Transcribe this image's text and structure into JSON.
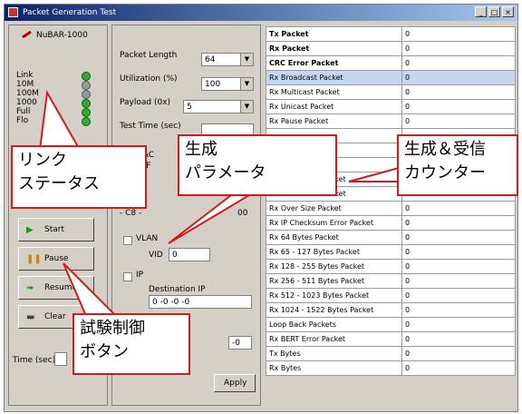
{
  "window": {
    "title": "Packet Generation Test",
    "min": "_",
    "max": "□",
    "close": "×"
  },
  "device": {
    "name": "NuBAR-1000"
  },
  "status_leds": [
    {
      "label": "Link",
      "state": "green"
    },
    {
      "label": "10M",
      "state": "gray"
    },
    {
      "label": "100M",
      "state": "gray"
    },
    {
      "label": "1000",
      "state": "green"
    },
    {
      "label": "Full",
      "state": "green"
    },
    {
      "label": "Flo",
      "state": "green"
    }
  ],
  "params": {
    "packet_length_label": "Packet Length",
    "packet_length_value": "64",
    "utilization_label": "Utilization (%)",
    "utilization_value": "100",
    "payload_label": "Payload (0x)",
    "payload_value": "5",
    "test_time_label": "Test Time (sec)",
    "mac_label": "MAC",
    "mac_value": "- FF",
    "mac2_value": "- C8 -",
    "mac2_tail": "00",
    "vlan_label": "VLAN",
    "vid_label": "VID",
    "vid_value": "0",
    "ip_label": "IP",
    "dest_ip_label": "Destination IP",
    "dest_ip_value": "0   -0   -0   -0",
    "src_tail": "-0",
    "apply_label": "Apply"
  },
  "controls": {
    "start": "Start",
    "pause": "Pause",
    "resume": "Resume",
    "clear": "Clear",
    "time_label": "Time (sec)"
  },
  "counters": [
    {
      "name": "Tx Packet",
      "value": "0",
      "bold": true
    },
    {
      "name": "Rx Packet",
      "value": "0",
      "bold": true
    },
    {
      "name": "CRC Error Packet",
      "value": "0",
      "bold": true
    },
    {
      "name": "Rx Broadcast Packet",
      "value": "0",
      "hl": true
    },
    {
      "name": "Rx Multicast Packet",
      "value": "0"
    },
    {
      "name": "Rx Unicast Packet",
      "value": "0"
    },
    {
      "name": "Rx Pause Packet",
      "value": "0"
    },
    {
      "name": "",
      "value": ""
    },
    {
      "name": "",
      "value": ""
    },
    {
      "name": "",
      "value": ""
    },
    {
      "name": "Rx Under Size Packet",
      "value": "0"
    },
    {
      "name": "Rx Under Size Packet",
      "value": "0"
    },
    {
      "name": "Rx Over Size Packet",
      "value": "0"
    },
    {
      "name": "Rx IP Checksum Error Packet",
      "value": "0"
    },
    {
      "name": "Rx 64 Bytes Packet",
      "value": "0"
    },
    {
      "name": "Rx 65 - 127 Bytes Packet",
      "value": "0"
    },
    {
      "name": "Rx 128 - 255 Bytes Packet",
      "value": "0"
    },
    {
      "name": "Rx 256 - 511 Bytes Packet",
      "value": "0"
    },
    {
      "name": "Rx 512 - 1023 Bytes Packet",
      "value": "0"
    },
    {
      "name": "Rx 1024 - 1522 Bytes Packet",
      "value": "0"
    },
    {
      "name": "Loop Back Packets",
      "value": "0"
    },
    {
      "name": "Rx BERT Error Packet",
      "value": "0"
    },
    {
      "name": "Tx Bytes",
      "value": "0"
    },
    {
      "name": "Rx Bytes",
      "value": "0"
    }
  ],
  "callouts": {
    "link_status": "リンク\nステータス",
    "gen_params": "生成\nパラメータ",
    "counters": "生成＆受信\nカウンター",
    "test_buttons": "試験制御\nボタン"
  },
  "colors": {
    "callout_border": "#d61a1a",
    "highlight_row": "#c7d6ef"
  }
}
